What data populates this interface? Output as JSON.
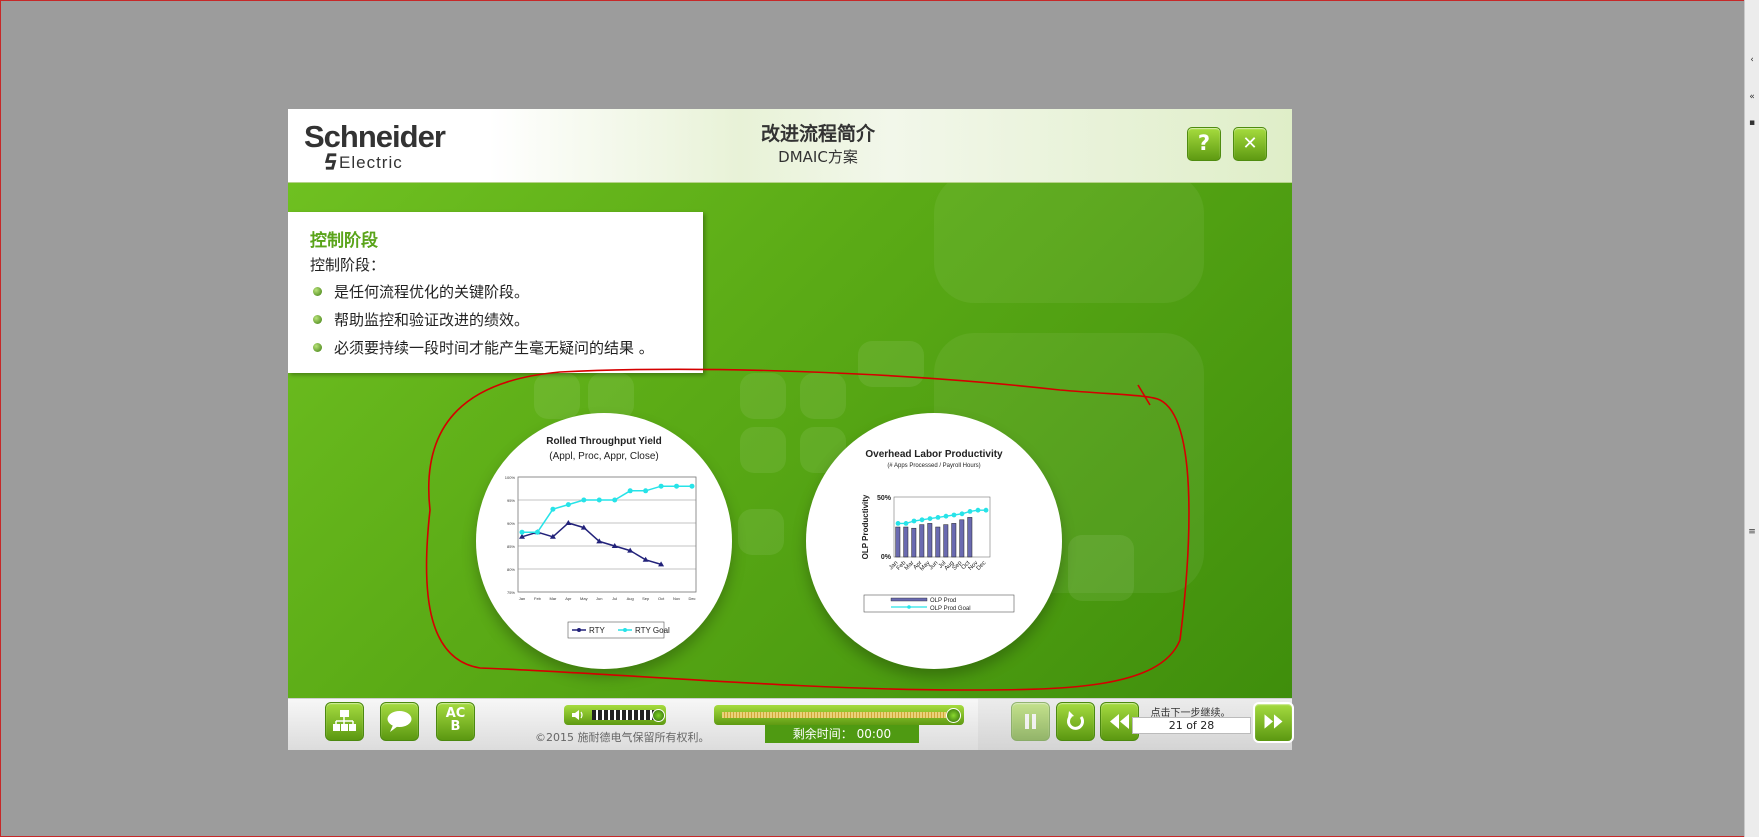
{
  "header": {
    "logo_top": "Schneider",
    "logo_bottom": "Electric",
    "title": "改进流程简介",
    "subtitle": "DMAIC方案",
    "help_label": "?",
    "close_label": "✕"
  },
  "content": {
    "heading": "控制阶段",
    "intro": "控制阶段：",
    "bullets": [
      "是任何流程优化的关键阶段。",
      "帮助监控和验证改进的绩效。",
      "必须要持续一段时间才能产生毫无疑问的结果 。"
    ]
  },
  "chart1": {
    "title": "Rolled Throughput Yield",
    "subtitle": "(Appl, Proc, Appr, Close)",
    "legend": [
      "RTY",
      "RTY Goal"
    ]
  },
  "chart2": {
    "title": "Overhead Labor Productivity",
    "subtitle": "(# Apps Processed / Payroll Hours)",
    "ylabel": "OLP Productivity",
    "ytick_top": "50%",
    "ytick_bottom": "0%",
    "legend": [
      "OLP Prod",
      "OLP Prod Goal"
    ]
  },
  "chart_data": [
    {
      "type": "line",
      "title": "Rolled Throughput Yield",
      "subtitle": "(Appl, Proc, Appr, Close)",
      "x": [
        "Jan",
        "Feb",
        "Mar",
        "Apr",
        "May",
        "Jun",
        "Jul",
        "Aug",
        "Sep",
        "Oct",
        "Nov",
        "Dec"
      ],
      "yticks": [
        "100%",
        "95%",
        "90%",
        "85%",
        "80%",
        "75%"
      ],
      "ylim": [
        75,
        100
      ],
      "series": [
        {
          "name": "RTY",
          "values": [
            87,
            88,
            87,
            90,
            89,
            86,
            85,
            84,
            82,
            81,
            null,
            null
          ],
          "color": "#22227a"
        },
        {
          "name": "RTY Goal",
          "values": [
            88,
            88,
            93,
            94,
            95,
            95,
            95,
            97,
            97,
            98,
            98,
            98
          ],
          "color": "#27e3e8"
        }
      ]
    },
    {
      "type": "bar",
      "title": "Overhead Labor Productivity",
      "subtitle": "(# Apps Processed / Payroll Hours)",
      "ylabel": "OLP Productivity",
      "ylim": [
        0,
        50
      ],
      "categories": [
        "Jan",
        "Feb",
        "Mar",
        "Apr",
        "May",
        "Jun",
        "Jul",
        "Aug",
        "Sep",
        "Oct",
        "Nov",
        "Dec"
      ],
      "series": [
        {
          "name": "OLP Prod",
          "values": [
            25,
            25,
            24,
            27,
            28,
            25,
            27,
            28,
            31,
            33,
            null,
            null
          ],
          "color": "#6a6ab0"
        },
        {
          "name": "OLP Prod Goal",
          "values": [
            28,
            28,
            30,
            31,
            32,
            33,
            34,
            35,
            36,
            38,
            39,
            39
          ],
          "color": "#27e3e8"
        }
      ]
    }
  ],
  "controls": {
    "btn_outline": "outline",
    "btn_notes": "notes",
    "btn_glossary": "AC\nB",
    "copyright": "©2015 施耐德电气保留所有权利。",
    "time_label": "剩余时间：  00:00",
    "next_hint": "点击下一步继续。",
    "page": "21 of 28",
    "volume_level": 0.9,
    "progress_level": 0.98
  },
  "colors": {
    "accent_green": "#5aa41a",
    "stage_green": "#5bab16",
    "annotation_red": "#d40000"
  }
}
